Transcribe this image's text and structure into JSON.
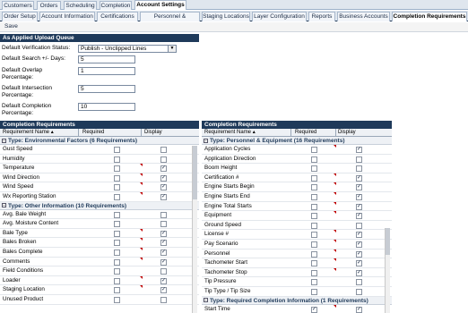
{
  "top_tabs": [
    "Customers",
    "Orders",
    "Scheduling",
    "Completion",
    "Account Settings"
  ],
  "sub_tabs": [
    "Order Setup",
    "Account Information",
    "Certifications",
    "Personnel & Equipment",
    "Staging Locations",
    "Layer Configuration",
    "Reports",
    "Business Accounts",
    "Completion Requirements"
  ],
  "toolbar": {
    "save_label": "Save"
  },
  "upload_queue": {
    "title": "As Applied Upload Queue",
    "verification_label": "Default Verification Status:",
    "verification_value": "Publish - Unclipped Lines",
    "search_label": "Default Search +/- Days:",
    "search_value": "5",
    "overlap_label1": "Default Overlap",
    "overlap_label2": "Percentage:",
    "overlap_value": "1",
    "intersection_label1": "Default Intersection",
    "intersection_label2": "Percentage:",
    "intersection_value": "5",
    "completion_label1": "Default Completion",
    "completion_label2": "Percentage:",
    "completion_value": "10"
  },
  "left_panel": {
    "title": "Completion Requirements",
    "col_name": "Requirement Name ▴",
    "col_required": "Required",
    "col_display": "Display",
    "groups": [
      {
        "title": "Type: Environmental Factors (6 Requirements)",
        "rows": [
          {
            "name": "Gust Speed",
            "required": false,
            "display": false,
            "flag": false
          },
          {
            "name": "Humidity",
            "required": false,
            "display": false,
            "flag": false
          },
          {
            "name": "Temperature",
            "required": false,
            "display": true,
            "flag": true
          },
          {
            "name": "Wind Direction",
            "required": false,
            "display": true,
            "flag": true
          },
          {
            "name": "Wind Speed",
            "required": false,
            "display": true,
            "flag": true
          },
          {
            "name": "Wx Reporting Station",
            "required": false,
            "display": true,
            "flag": true
          }
        ]
      },
      {
        "title": "Type: Other Information (10 Requirements)",
        "rows": [
          {
            "name": "Avg. Bale Weight",
            "required": false,
            "display": false,
            "flag": false
          },
          {
            "name": "Avg. Moisture Content",
            "required": false,
            "display": false,
            "flag": false
          },
          {
            "name": "Bale Type",
            "required": false,
            "display": true,
            "flag": true
          },
          {
            "name": "Bales Broken",
            "required": false,
            "display": true,
            "flag": true
          },
          {
            "name": "Bales Complete",
            "required": false,
            "display": true,
            "flag": true
          },
          {
            "name": "Comments",
            "required": false,
            "display": true,
            "flag": true
          },
          {
            "name": "Field Conditions",
            "required": false,
            "display": false,
            "flag": false
          },
          {
            "name": "Loader",
            "required": false,
            "display": true,
            "flag": true
          },
          {
            "name": "Staging Location",
            "required": false,
            "display": true,
            "flag": true
          },
          {
            "name": "Unused Product",
            "required": false,
            "display": false,
            "flag": false
          }
        ]
      }
    ]
  },
  "right_panel": {
    "title": "Completion Requirements",
    "col_name": "Requirement Name ▴",
    "col_required": "Required",
    "col_display": "Display",
    "groups": [
      {
        "title": "Type: Personnel & Equipment (16 Requirements)",
        "rows": [
          {
            "name": "Application Cycles",
            "required": false,
            "display": true,
            "flag": true
          },
          {
            "name": "Application Direction",
            "required": false,
            "display": false,
            "flag": false
          },
          {
            "name": "Boom Height",
            "required": false,
            "display": false,
            "flag": false
          },
          {
            "name": "Certification #",
            "required": false,
            "display": true,
            "flag": true
          },
          {
            "name": "Engine Starts Begin",
            "required": false,
            "display": true,
            "flag": true
          },
          {
            "name": "Engine Starts End",
            "required": false,
            "display": true,
            "flag": true
          },
          {
            "name": "Engine Total Starts",
            "required": false,
            "display": true,
            "flag": true
          },
          {
            "name": "Equipment",
            "required": false,
            "display": true,
            "flag": true
          },
          {
            "name": "Ground Speed",
            "required": false,
            "display": false,
            "flag": false
          },
          {
            "name": "License #",
            "required": false,
            "display": true,
            "flag": true
          },
          {
            "name": "Pay Scenario",
            "required": false,
            "display": true,
            "flag": true
          },
          {
            "name": "Personnel",
            "required": false,
            "display": true,
            "flag": true
          },
          {
            "name": "Tachometer Start",
            "required": false,
            "display": true,
            "flag": true
          },
          {
            "name": "Tachometer Stop",
            "required": false,
            "display": true,
            "flag": true
          },
          {
            "name": "Tip Pressure",
            "required": false,
            "display": false,
            "flag": false
          },
          {
            "name": "Tip Type / Tip Size",
            "required": false,
            "display": false,
            "flag": false
          }
        ]
      },
      {
        "title": "Type: Required Completion Information (1 Requirements)",
        "rows": [
          {
            "name": "Start Time",
            "required": true,
            "display": true,
            "flag": true
          }
        ]
      }
    ]
  },
  "colors": {
    "header_bg": "#1f3a5a",
    "flag": "#c00000"
  },
  "icons": {
    "expand": "minus-box-icon",
    "dropdown": "chevron-down-icon",
    "check": "check-icon"
  }
}
